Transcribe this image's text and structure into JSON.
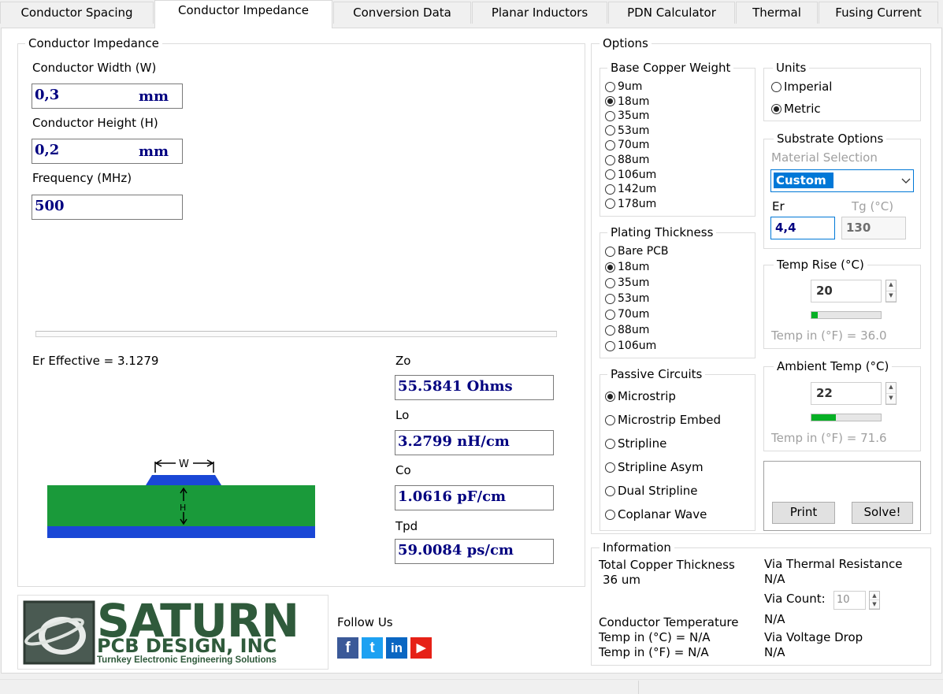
{
  "tabs": [
    "Conductor Spacing",
    "Conductor Impedance",
    "Conversion Data",
    "Planar Inductors",
    "PDN Calculator",
    "Thermal",
    "Fusing Current"
  ],
  "impedance": {
    "group_title": "Conductor Impedance",
    "width_label": "Conductor Width (W)",
    "width_value": "0,3",
    "width_unit": "mm",
    "height_label": "Conductor Height (H)",
    "height_value": "0,2",
    "height_unit": "mm",
    "freq_label": "Frequency (MHz)",
    "freq_value": "500",
    "er_effective": "Er Effective = 3.1279",
    "zo_label": "Zo",
    "zo_value": "55.5841 Ohms",
    "lo_label": "Lo",
    "lo_value": "3.2799 nH/cm",
    "co_label": "Co",
    "co_value": "1.0616 pF/cm",
    "tpd_label": "Tpd",
    "tpd_value": "59.0084 ps/cm",
    "diagram_w": "W",
    "diagram_h": "H"
  },
  "options": {
    "group_title": "Options",
    "base_copper": {
      "title": "Base Copper Weight",
      "items": [
        "9um",
        "18um",
        "35um",
        "53um",
        "70um",
        "88um",
        "106um",
        "142um",
        "178um"
      ],
      "selected": "18um"
    },
    "plating": {
      "title": "Plating Thickness",
      "items": [
        "Bare PCB",
        "18um",
        "35um",
        "53um",
        "70um",
        "88um",
        "106um"
      ],
      "selected": "18um"
    },
    "passive": {
      "title": "Passive Circuits",
      "items": [
        "Microstrip",
        "Microstrip Embed",
        "Stripline",
        "Stripline Asym",
        "Dual Stripline",
        "Coplanar Wave"
      ],
      "selected": "Microstrip"
    },
    "units": {
      "title": "Units",
      "items": [
        "Imperial",
        "Metric"
      ],
      "selected": "Metric"
    },
    "substrate": {
      "title": "Substrate Options",
      "material_label": "Material Selection",
      "material_value": "Custom",
      "er_label": "Er",
      "er_value": "4,4",
      "tg_label": "Tg (°C)",
      "tg_value": "130"
    },
    "temp_rise": {
      "title": "Temp Rise (°C)",
      "value": "20",
      "level": 0.09,
      "fahrenheit": "Temp in (°F) = 36.0"
    },
    "ambient": {
      "title": "Ambient Temp (°C)",
      "value": "22",
      "level": 0.35,
      "fahrenheit": "Temp in (°F) = 71.6"
    },
    "print_label": "Print",
    "solve_label": "Solve!"
  },
  "information": {
    "title": "Information",
    "total_copper_label": "Total Copper Thickness",
    "total_copper_value": "36 um",
    "cond_temp_label": "Conductor Temperature",
    "temp_c": "Temp in (°C) = N/A",
    "temp_f": "Temp in (°F) = N/A",
    "via_thermal_label": "Via Thermal Resistance",
    "via_thermal_value": "N/A",
    "via_count_label": "Via Count:",
    "via_count_value": "10",
    "via_count_result": "N/A",
    "via_drop_label": "Via Voltage Drop",
    "via_drop_value": "N/A"
  },
  "branding": {
    "logo_main": "SATURN",
    "logo_sub": "PCB DESIGN, INC",
    "logo_tag": "Turnkey Electronic Engineering Solutions",
    "follow_us": "Follow Us",
    "social": [
      "f",
      "t",
      "in",
      "▶"
    ]
  },
  "colors": {
    "value_text": "#000080",
    "selected_highlight": "#0078d7",
    "progress_fill": "#06b025",
    "board_green": "#1a9a3a",
    "copper_blue": "#1a47d6"
  }
}
